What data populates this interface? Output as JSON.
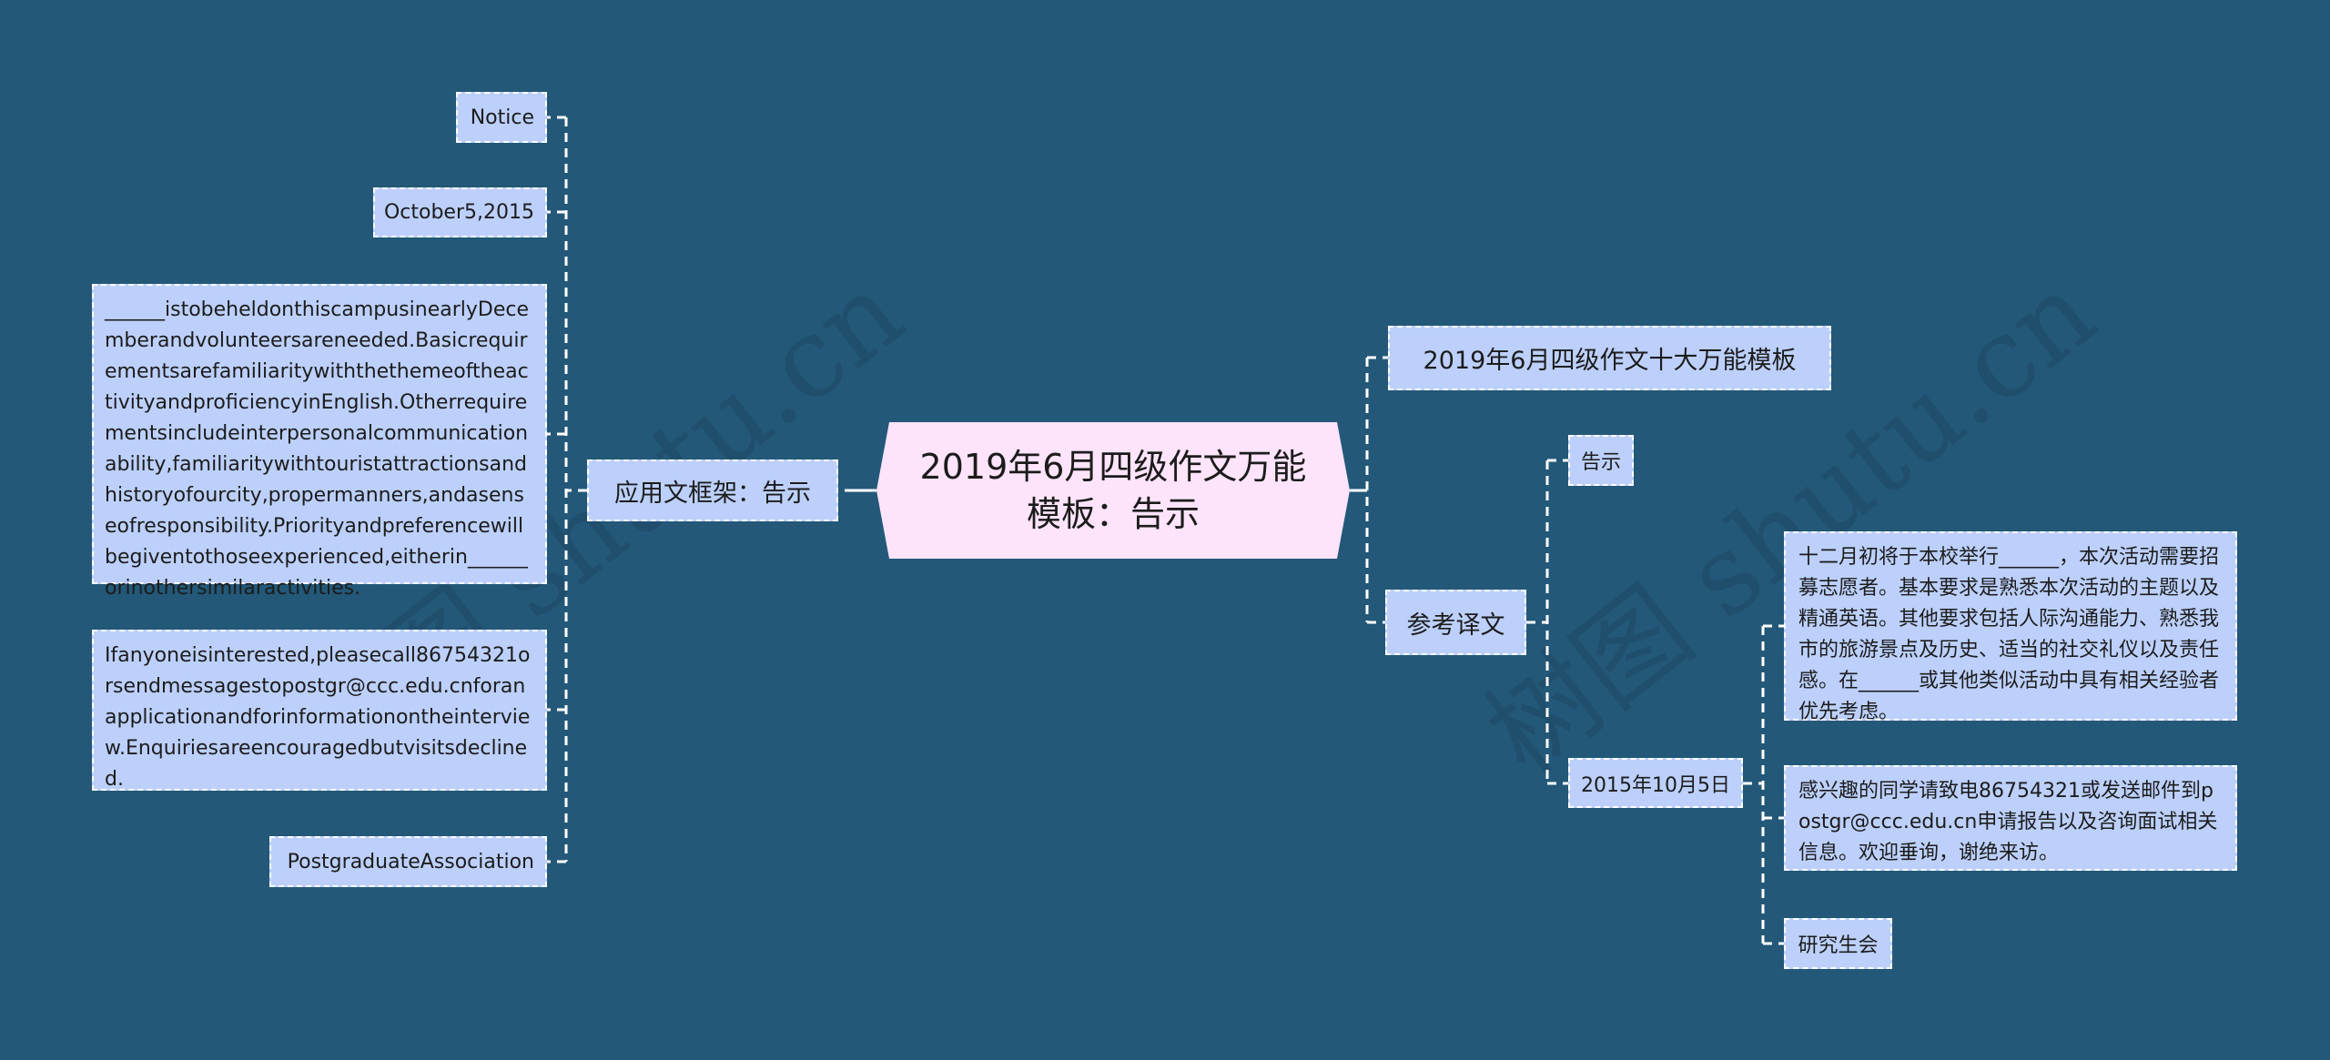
{
  "colors": {
    "background": "#235878",
    "node_fill": "#bcd0fb",
    "center_fill": "#fde4fa",
    "connector": "#ffffff",
    "text": "#1c1c1c"
  },
  "center": {
    "title": "2019年6月四级作文万能模板：告示"
  },
  "left": {
    "branch": {
      "label": "应用文框架：告示",
      "children": [
        {
          "text": "Notice"
        },
        {
          "text": "October5,2015"
        },
        {
          "text": "______istobeheldonthiscampusinearlyDecemberandvolunteersareneeded.BasicrequirementsarefamiliaritywiththethemeoftheactivityandproficiencyinEnglish.Otherrequirementsincludeinterpersonalcommunicationability,familiaritywithtouristattractionsandhistoryofourcity,propermanners,andasenseofresponsibility.Priorityandpreferencewillbegiventothoseexperienced,eitherin______orinothersimilaractivities."
        },
        {
          "text": "Ifanyoneisinterested,pleasecall86754321orsendmessagestopostgr@ccc.edu.cnforanapplicationandforinformationontheinterview.Enquiriesareencouragedbutvisitsdeclined."
        },
        {
          "text": "PostgraduateAssociation"
        }
      ]
    }
  },
  "right": {
    "branches": [
      {
        "label": "2019年6月四级作文十大万能模板"
      },
      {
        "label": "参考译文",
        "children": [
          {
            "text": "告示"
          },
          {
            "text": "2015年10月5日",
            "children": [
              {
                "text": "十二月初将于本校举行______，本次活动需要招募志愿者。基本要求是熟悉本次活动的主题以及精通英语。其他要求包括人际沟通能力、熟悉我市的旅游景点及历史、适当的社交礼仪以及责任感。在______或其他类似活动中具有相关经验者优先考虑。"
              },
              {
                "text": "感兴趣的同学请致电86754321或发送邮件到postgr@ccc.edu.cn申请报告以及咨询面试相关信息。欢迎垂询，谢绝来访。"
              },
              {
                "text": "研究生会"
              }
            ]
          }
        ]
      }
    ]
  },
  "watermarks": [
    "树图 shutu.cn",
    "树图 shutu.cn"
  ]
}
